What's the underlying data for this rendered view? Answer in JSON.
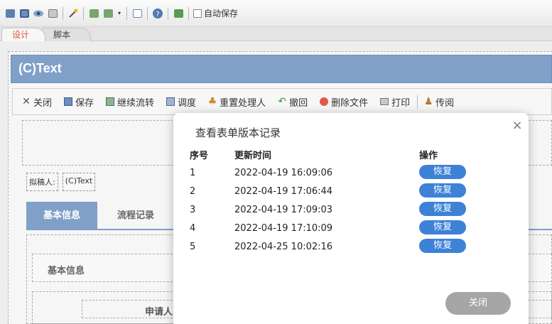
{
  "toolbar": {
    "autosave_label": "自动保存",
    "icons": [
      "new-icon",
      "save-icon",
      "preview-icon",
      "print-icon",
      "wand-icon",
      "import-icon",
      "export-icon",
      "form-icon",
      "help-icon",
      "image-icon"
    ]
  },
  "tabs": {
    "design": "设计",
    "script": "脚本"
  },
  "form": {
    "title": "(C)Text",
    "actions": [
      "关闭",
      "保存",
      "继续流转",
      "调度",
      "重置处理人",
      "撤回",
      "删除文件",
      "打印",
      "传阅"
    ],
    "drafter_label": "拟稿人:",
    "drafter_value": "(C)Text",
    "tabs": [
      "基本信息",
      "流程记录"
    ],
    "section_title": "基本信息",
    "applicant_label": "申请人"
  },
  "modal": {
    "title": "查看表单版本记录",
    "columns": [
      "序号",
      "更新时间",
      "操作"
    ],
    "rows": [
      {
        "no": "1",
        "time": "2022-04-19 16:09:06",
        "action": "恢复"
      },
      {
        "no": "2",
        "time": "2022-04-19 17:06:44",
        "action": "恢复"
      },
      {
        "no": "3",
        "time": "2022-04-19 17:09:03",
        "action": "恢复"
      },
      {
        "no": "4",
        "time": "2022-04-19 17:10:09",
        "action": "恢复"
      },
      {
        "no": "5",
        "time": "2022-04-25 10:02:16",
        "action": "恢复"
      }
    ],
    "close_label": "关闭",
    "close_icon": "×"
  },
  "colors": {
    "accent": "#80a0c8",
    "restore": "#3d82d6",
    "close": "#a6a6a6",
    "design_tab": "#e0553b"
  }
}
